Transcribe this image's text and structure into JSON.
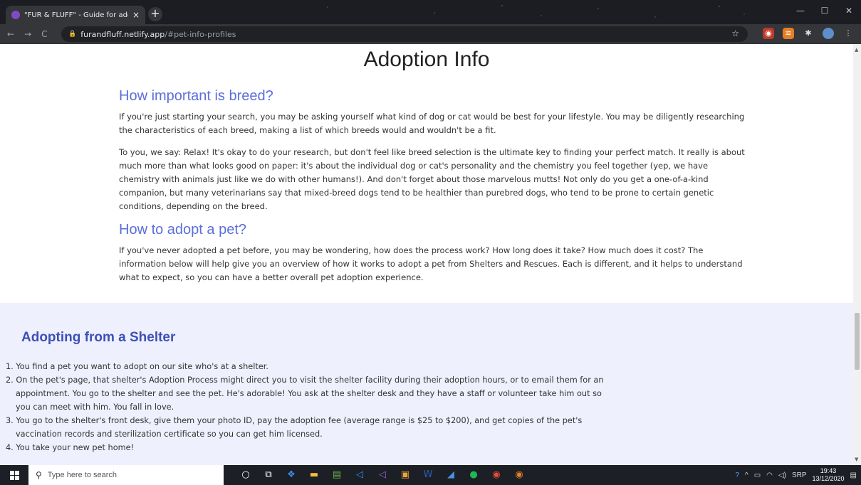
{
  "browser": {
    "tab_title": "\"FUR & FLUFF\" - Guide for adopt",
    "tab_close": "×",
    "new_tab": "+",
    "url_host": "furandfluff.netlify.app",
    "url_fragment": "/#pet-info-profiles",
    "window_controls": {
      "minimize": "—",
      "maximize": "☐",
      "close": "✕"
    },
    "nav": {
      "back": "←",
      "forward": "→",
      "reload": "C"
    }
  },
  "page": {
    "section_title": "Adoption Info",
    "breed": {
      "heading": "How important is breed?",
      "p1": "If you're just starting your search, you may be asking yourself what kind of dog or cat would be best for your lifestyle. You may be diligently researching the characteristics of each breed, making a list of which breeds would and wouldn't be a fit.",
      "p2": "To you, we say: Relax! It's okay to do your research, but don't feel like breed selection is the ultimate key to finding your perfect match. It really is about much more than what looks good on paper: it's about the individual dog or cat's personality and the chemistry you feel together (yep, we have chemistry with animals just like we do with other humans!). And don't forget about those marvelous mutts! Not only do you get a one-of-a-kind companion, but many veterinarians say that mixed-breed dogs tend to be healthier than purebred dogs, who tend to be prone to certain genetic conditions, depending on the breed."
    },
    "adopt": {
      "heading": "How to adopt a pet?",
      "p1": "If you've never adopted a pet before, you may be wondering, how does the process work? How long does it take? How much does it cost? The information below will help give you an overview of how it works to adopt a pet from Shelters and Rescues. Each is different, and it helps to understand what to expect, so you can have a better overall pet adoption experience."
    },
    "shelter": {
      "heading": "Adopting from a Shelter",
      "steps": [
        "1. You find a pet you want to adopt on our site who's at a shelter.",
        "2. On the pet's page, that shelter's Adoption Process might direct you to visit the shelter facility during their adoption hours, or to email them for an appointment. You go to the shelter and see the pet. He's adorable! You ask at the shelter desk and they have a staff or volunteer take him out so you can meet with him. You fall in love.",
        "3. You go to the shelter's front desk, give them your photo ID, pay the adoption fee (average range is $25 to $200), and get copies of the pet's vaccination records and sterilization certificate so you can get him licensed.",
        "4. You take your new pet home!"
      ]
    }
  },
  "taskbar": {
    "search_placeholder": "Type here to search",
    "lang": "SRP",
    "time": "19:43",
    "date": "13/12/2020"
  },
  "colors": {
    "heading_blue": "#5a6fdb",
    "shelter_heading": "#3e50b5",
    "shelter_band": "#eef0fd"
  }
}
